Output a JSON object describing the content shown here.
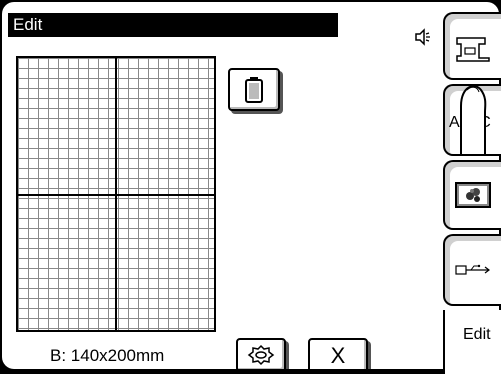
{
  "header": {
    "title": "Edit"
  },
  "sidebar": {
    "tabs": [
      {
        "id": "machine",
        "icon": "sewing-machine-icon"
      },
      {
        "id": "abc",
        "label": "A.B.C"
      },
      {
        "id": "design",
        "icon": "design-picture-icon"
      },
      {
        "id": "usb",
        "icon": "usb-icon"
      },
      {
        "id": "edit",
        "label": "Edit",
        "selected": true
      }
    ]
  },
  "main": {
    "hoop_status": "B: 140x200mm",
    "close_label": "X",
    "frame_button_icon": "hoop-frame-icon",
    "settings_button_icon": "gear-icon"
  },
  "colors": {
    "background": "#000000",
    "screen": "#ffffff",
    "grid": "#888888"
  }
}
